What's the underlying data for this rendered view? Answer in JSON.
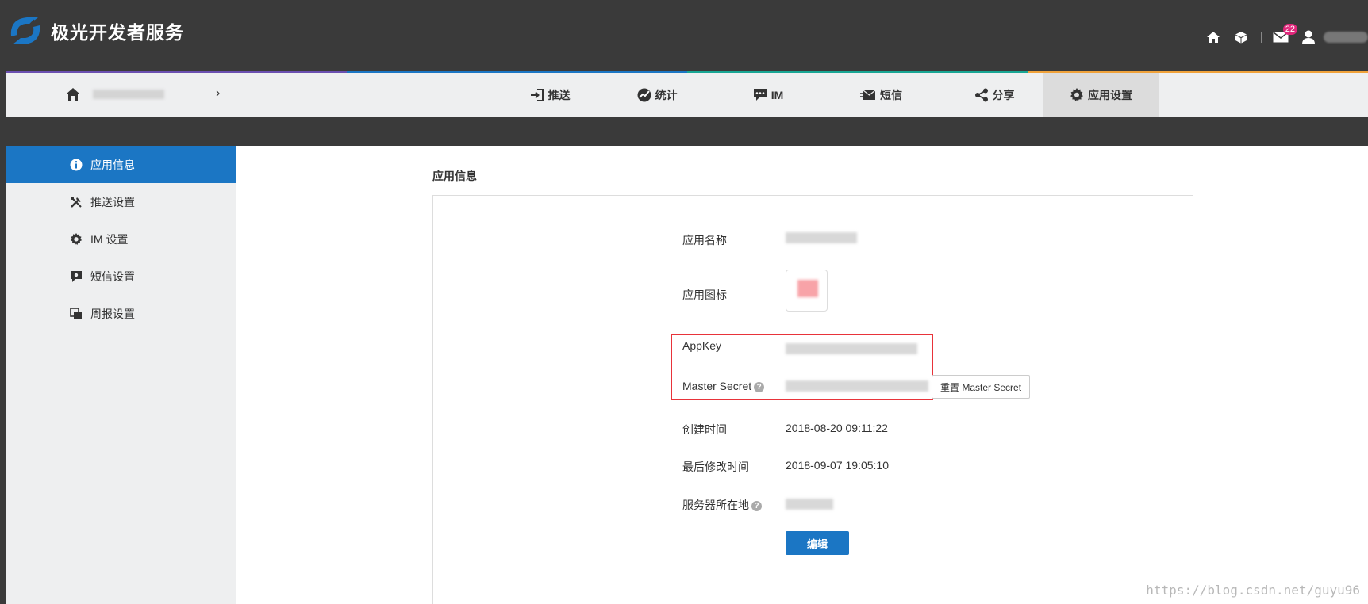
{
  "brand": {
    "name": "极光开发者服务"
  },
  "header": {
    "icons": [
      "home-icon",
      "cube-icon",
      "mail-icon",
      "user-icon"
    ],
    "mail_badge": "22"
  },
  "stripe_colors": [
    "#6a4fb0",
    "#1b76c4",
    "#18a694",
    "#f0a23a"
  ],
  "breadcrumb": {
    "arrow": "›"
  },
  "nav": {
    "tabs": [
      {
        "label": "推送",
        "icon": "sign-in-icon"
      },
      {
        "label": "统计",
        "icon": "chart-icon"
      },
      {
        "label": "IM",
        "icon": "chat-icon"
      },
      {
        "label": "短信",
        "icon": "send-mail-icon"
      },
      {
        "label": "分享",
        "icon": "share-icon"
      },
      {
        "label": "应用设置",
        "icon": "gear-icon",
        "active": true
      }
    ]
  },
  "sidebar": {
    "items": [
      {
        "label": "应用信息",
        "icon": "info-icon",
        "active": true
      },
      {
        "label": "推送设置",
        "icon": "tools-icon"
      },
      {
        "label": "IM 设置",
        "icon": "gear-icon"
      },
      {
        "label": "短信设置",
        "icon": "sms-icon"
      },
      {
        "label": "周报设置",
        "icon": "copy-icon"
      }
    ]
  },
  "main": {
    "section_title": "应用信息",
    "fields": {
      "app_name_label": "应用名称",
      "app_icon_label": "应用图标",
      "appkey_label": "AppKey",
      "master_secret_label": "Master Secret",
      "reset_button": "重置 Master Secret",
      "created_label": "创建时间",
      "created_value": "2018-08-20 09:11:22",
      "modified_label": "最后修改时间",
      "modified_value": "2018-09-07 19:05:10",
      "server_label": "服务器所在地",
      "help_glyph": "?",
      "edit_button": "编辑"
    }
  },
  "watermark": "https://blog.csdn.net/guyu96",
  "colors": {
    "accent": "#1b76c4",
    "highlight": "#e8333a",
    "badge": "#e0267a"
  }
}
